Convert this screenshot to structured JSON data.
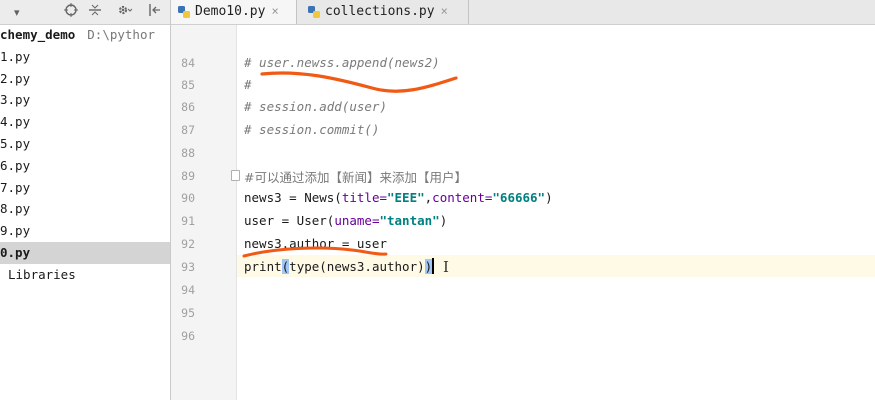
{
  "sidebar": {
    "toolbar": {
      "arrow": "▾",
      "target_icon": "crosshair-icon",
      "collapse_icon": "collapse-all-icon",
      "gear_icon": "gear-icon",
      "hide_icon": "hide-panel-icon"
    },
    "project": {
      "name": "chemy_demo",
      "path": "D:\\pythor"
    },
    "files": [
      "1.py",
      "2.py",
      "3.py",
      "4.py",
      "5.py",
      "6.py",
      "7.py",
      "8.py",
      "9.py",
      "0.py"
    ],
    "selected_index": 9,
    "external": "Libraries"
  },
  "tabs": [
    {
      "label": "Demo10.py",
      "close": "×"
    },
    {
      "label": "collections.py",
      "close": "×"
    }
  ],
  "editor": {
    "line_numbers": [
      "84",
      "85",
      "86",
      "87",
      "88",
      "89",
      "90",
      "91",
      "92",
      "93",
      "94",
      "95",
      "96"
    ],
    "lines": {
      "l84": "# user.newss.append(news2)",
      "l85": "#",
      "l86": "# session.add(user)",
      "l87": "# session.commit()",
      "l89": "#可以通过添加【新闻】来添加【用户】",
      "l90": {
        "a": "news3 = News(",
        "b": "title=",
        "c": "\"EEE\"",
        "d": ",",
        "e": "content=",
        "f": "\"66666\"",
        "g": ")"
      },
      "l91": {
        "a": "user = User(",
        "b": "uname=",
        "c": "\"tantan\"",
        "d": ")"
      },
      "l92": "news3.author = user",
      "l93": {
        "a": "print",
        "b": "(",
        "c": "type(news3.author)",
        "d": ")"
      }
    },
    "current_line": "93",
    "cursor_glyph": "I"
  },
  "colors": {
    "annotation": "#f05a14",
    "string": "#008080",
    "keyword_arg": "#660099",
    "comment": "#7a7a7a",
    "caret_line": "#fffae6"
  }
}
